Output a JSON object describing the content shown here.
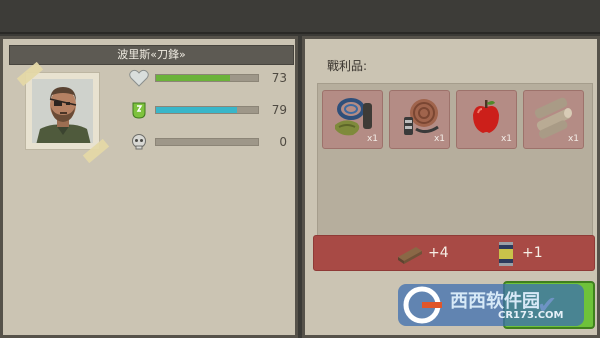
{
  "character": {
    "name": "波里斯«刀鋒»"
  },
  "stats": [
    {
      "icon": "heart-icon",
      "value": "73",
      "fraction": 0.73,
      "color": "#6bb33a"
    },
    {
      "icon": "water-drop-icon",
      "value": "79",
      "fraction": 0.79,
      "color": "#39b6c9"
    },
    {
      "icon": "skull-icon",
      "value": "0",
      "fraction": 0.0,
      "color": "#8d8d8d"
    }
  ],
  "loot": {
    "title": "戰利品:",
    "items": [
      {
        "icon": "rope-and-cloth-icon",
        "qty": "x1"
      },
      {
        "icon": "rope-coil-icon",
        "qty": "x1"
      },
      {
        "icon": "apple-icon",
        "qty": "x1"
      },
      {
        "icon": "wood-logs-icon",
        "qty": "x1"
      }
    ],
    "summary": [
      {
        "icon": "plank-icon",
        "value": "+4"
      },
      {
        "icon": "canned-food-icon",
        "value": "+1"
      }
    ]
  },
  "watermark": {
    "text": "西西软件园",
    "sub": "CR173.COM"
  },
  "colors": {
    "panel": "#cbc4b3",
    "banner": "#5d5a53",
    "slot": "#b48c85",
    "summary": "#a84a45",
    "confirm": "#6ec23a"
  }
}
